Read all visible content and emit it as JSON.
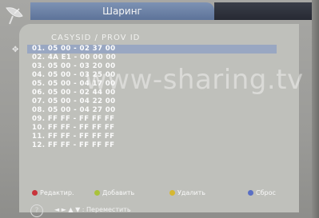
{
  "window": {
    "title": "Шаринг"
  },
  "table": {
    "header": "CASYSID / PROV ID",
    "rows": [
      "01. 05 00 - 02 37 00",
      "02. 4A E1 - 00 00 00",
      "03. 05 00 - 03 20 00",
      "04. 05 00 - 03 25 00",
      "05. 05 00 - 04 17 00",
      "06. 05 00 - 02 44 00",
      "07. 05 00 - 04 22 00",
      "08. 05 00 - 04 27 00",
      "09. FF FF - FF FF FF",
      "10. FF FF - FF FF FF",
      "11. FF FF - FF FF FF",
      "12. FF FF - FF FF FF"
    ],
    "selected_index": 0
  },
  "footer": {
    "edit_label": "Редактир.",
    "add_label": "Добавить",
    "delete_label": "Удалить",
    "reset_label": "Сброс",
    "colors": {
      "red": "#c8333a",
      "green": "#a9c23a",
      "yellow": "#d6b832",
      "blue": "#5a6fc4"
    }
  },
  "nav": {
    "hint": "◄ ► ▲ ▼ : Переместить"
  },
  "watermark": "www-sharing.tv"
}
